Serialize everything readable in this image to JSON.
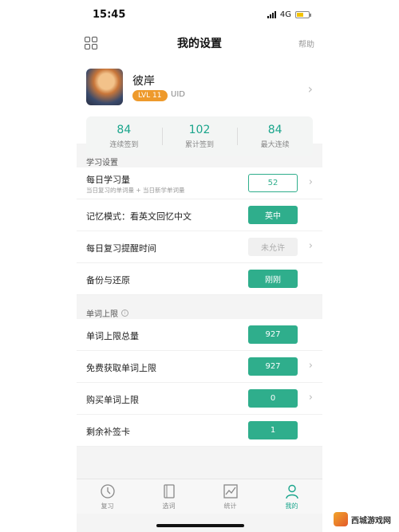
{
  "status_bar": {
    "time": "15:45",
    "network": "4G"
  },
  "nav": {
    "title": "我的设置",
    "right_label": "帮助"
  },
  "profile": {
    "name": "彼岸",
    "level": "LVL 11",
    "uid": "UID"
  },
  "stats": [
    {
      "value": "84",
      "label": "连续签到"
    },
    {
      "value": "102",
      "label": "累计签到"
    },
    {
      "value": "84",
      "label": "最大连续"
    }
  ],
  "study_section": {
    "title": "学习设置",
    "daily": {
      "title": "每日学习量",
      "subtitle": "当日复习的单词量 + 当日新学单词量",
      "value": "52"
    },
    "memory_mode": {
      "title": "记忆模式：看英文回忆中文",
      "value": "英中"
    },
    "reminder": {
      "title": "每日复习提醒时间",
      "value": "未允许"
    },
    "backup": {
      "title": "备份与还原",
      "value": "刚刚"
    }
  },
  "limit_section": {
    "title": "单词上限",
    "total": {
      "title": "单词上限总量",
      "value": "927"
    },
    "free": {
      "title": "免费获取单词上限",
      "value": "927"
    },
    "buy": {
      "title": "购买单词上限",
      "value": "0"
    },
    "cards": {
      "title": "剩余补签卡",
      "value": "1"
    }
  },
  "tabs": [
    {
      "label": "复习",
      "icon": "review-icon"
    },
    {
      "label": "选词",
      "icon": "book-icon"
    },
    {
      "label": "统计",
      "icon": "stats-icon"
    },
    {
      "label": "我的",
      "icon": "user-icon"
    }
  ],
  "watermark": {
    "text": "西城游戏网"
  },
  "colors": {
    "accent": "#2fae8c",
    "level_badge": "#ee9a2c"
  }
}
